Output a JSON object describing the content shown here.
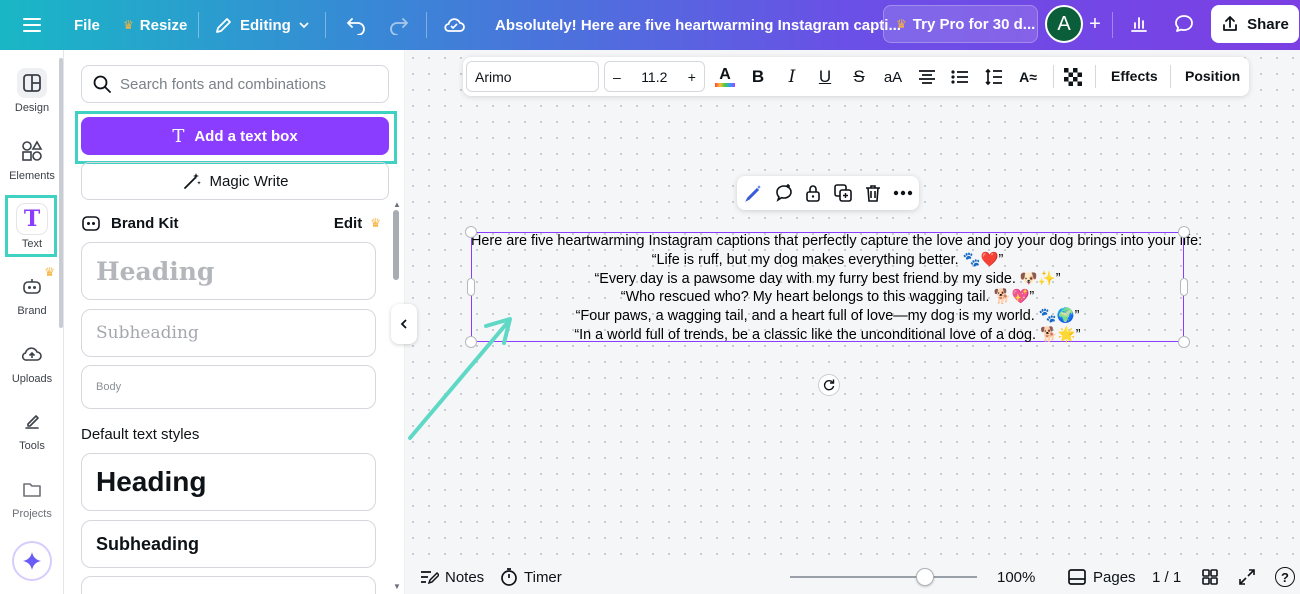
{
  "topbar": {
    "file_label": "File",
    "resize_label": "Resize",
    "editing_label": "Editing",
    "doc_title": "Absolutely! Here are five heartwarming Instagram capti...",
    "pro_label": "Try Pro for 30 d...",
    "avatar_letter": "A",
    "share_label": "Share"
  },
  "rail": {
    "items": [
      {
        "label": "Design",
        "icon": "design-icon"
      },
      {
        "label": "Elements",
        "icon": "elements-icon"
      },
      {
        "label": "Text",
        "icon": "text-icon"
      },
      {
        "label": "Brand",
        "icon": "brand-icon"
      },
      {
        "label": "Uploads",
        "icon": "uploads-icon"
      },
      {
        "label": "Tools",
        "icon": "tools-icon"
      },
      {
        "label": "Projects",
        "icon": "projects-icon"
      }
    ]
  },
  "panel": {
    "search_placeholder": "Search fonts and combinations",
    "add_textbox_label": "Add a text box",
    "magic_write_label": "Magic Write",
    "brand_kit_label": "Brand Kit",
    "brand_kit_edit": "Edit",
    "brand_heading": "Heading",
    "brand_subheading": "Subheading",
    "brand_body": "Body",
    "default_styles_title": "Default text styles",
    "default_heading": "Heading",
    "default_subheading": "Subheading"
  },
  "format_bar": {
    "font": "Arimo",
    "size_minus": "–",
    "size": "11.2",
    "size_plus": "+",
    "effects_label": "Effects",
    "position_label": "Position",
    "case_label": "aA"
  },
  "textbox": {
    "lines": [
      "Here are five heartwarming Instagram captions that perfectly capture the love and joy your dog brings into your life:",
      "“Life is ruff, but my dog makes everything better. 🐾❤️”",
      "“Every day is a pawsome day with my furry best friend by my side. 🐶✨”",
      "“Who rescued who? My heart belongs to this wagging tail. 🐕💖”",
      "“Four paws, a wagging tail, and a heart full of love—my dog is my world. 🐾🌍”",
      "“In a world full of trends, be a classic like the unconditional love of a dog. 🐕🌟”"
    ]
  },
  "bottombar": {
    "notes_label": "Notes",
    "timer_label": "Timer",
    "zoom_label": "100%",
    "zoom_value": 0.72,
    "pages_label": "Pages",
    "page_count": "1 / 1",
    "help_label": "?"
  },
  "colors": {
    "accent": "#8b3dff",
    "highlight": "#3fd2c2",
    "crown": "#f6b33d",
    "avatar_bg": "#0b5e3a"
  }
}
